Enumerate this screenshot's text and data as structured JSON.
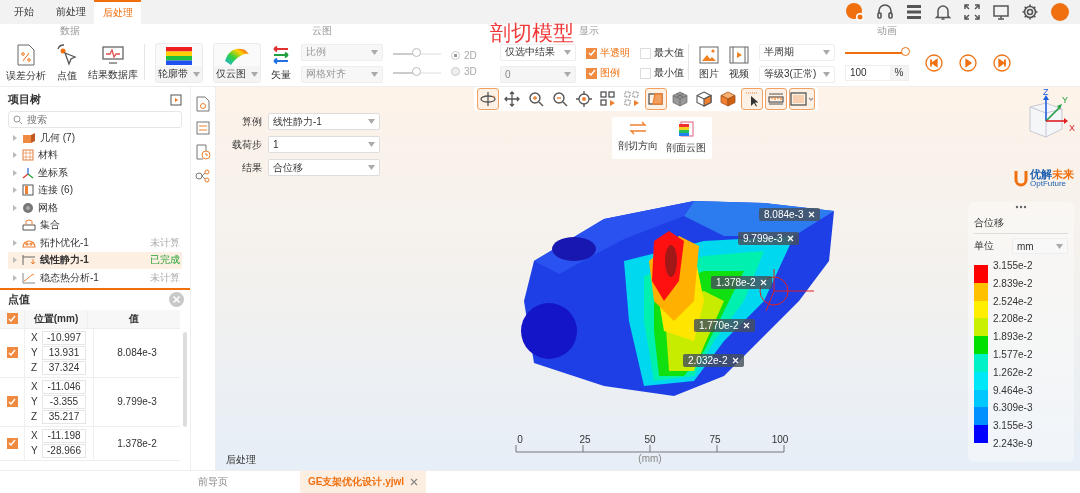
{
  "top_tabs": [
    {
      "label": "开始",
      "selected": false
    },
    {
      "label": "前处理",
      "selected": false
    },
    {
      "label": "后处理",
      "selected": true
    }
  ],
  "annotation_title": "剖切模型",
  "ribbon": {
    "data": {
      "title": "数据",
      "buttons": [
        {
          "kind": "error",
          "label": "误差分析"
        },
        {
          "kind": "probe",
          "label": "点值"
        },
        {
          "kind": "database",
          "label": "结果数据库"
        }
      ]
    },
    "contour": {
      "title": "云图",
      "band_button": "轮廓带",
      "cloud_button": "仅云图",
      "vector_button": "矢量",
      "scale_select": "比例",
      "mesh_select": "网格对齐",
      "sliders": [
        {
          "level": 0.5
        },
        {
          "level": 0.5
        }
      ],
      "modes": [
        {
          "label": "2D",
          "selected": true
        },
        {
          "label": "3D",
          "selected": false
        }
      ]
    },
    "display": {
      "title": "显示",
      "result_select": "仅选中结果",
      "step_select": "0",
      "checks": [
        {
          "label": "半透明",
          "checked": true
        },
        {
          "label": "最大值",
          "checked": false
        },
        {
          "label": "图例",
          "checked": true
        },
        {
          "label": "最小值",
          "checked": false
        }
      ]
    },
    "animation": {
      "title": "动画",
      "image_button": "图片",
      "video_button": "视频",
      "period_select": "半周期",
      "grade_select": "等级3(正常)",
      "speed": {
        "level": 1
      },
      "percent_value": "100",
      "percent_unit": "%"
    }
  },
  "project_tree": {
    "title": "项目树",
    "search_placeholder": "搜索",
    "items": [
      {
        "label": "几何 (7)",
        "kind": "geometry",
        "expandable": true,
        "selected": false
      },
      {
        "label": "材料",
        "kind": "material",
        "expandable": true,
        "selected": false
      },
      {
        "label": "坐标系",
        "kind": "axes",
        "expandable": true,
        "selected": false
      },
      {
        "label": "连接 (6)",
        "kind": "connection",
        "expandable": true,
        "selected": false
      },
      {
        "label": "网格",
        "kind": "mesh",
        "expandable": true,
        "selected": false
      },
      {
        "label": "集合",
        "kind": "set",
        "expandable": false,
        "selected": false
      },
      {
        "label": "拓扑优化-1",
        "kind": "topology",
        "expandable": true,
        "selected": false,
        "status": "未计算",
        "done": false
      },
      {
        "label": "线性静力-1",
        "kind": "static",
        "expandable": true,
        "selected": true,
        "status": "已完成",
        "done": true
      },
      {
        "label": "稳态热分析-1",
        "kind": "thermal",
        "expandable": true,
        "selected": false,
        "status": "未计算",
        "done": false
      }
    ]
  },
  "point_values": {
    "title": "点值",
    "all_checked": true,
    "columns": [
      "位置(mm)",
      "值"
    ],
    "rows": [
      {
        "checked": true,
        "coords": [
          {
            "axis": "X",
            "value": "-10.997"
          },
          {
            "axis": "Y",
            "value": "13.931"
          },
          {
            "axis": "Z",
            "value": "37.324"
          }
        ],
        "value": "8.084e-3"
      },
      {
        "checked": true,
        "coords": [
          {
            "axis": "X",
            "value": "-11.046"
          },
          {
            "axis": "Y",
            "value": "-3.355"
          },
          {
            "axis": "Z",
            "value": "35.217"
          }
        ],
        "value": "9.799e-3"
      },
      {
        "checked": true,
        "coords": [
          {
            "axis": "X",
            "value": "-11.198"
          },
          {
            "axis": "Y",
            "value": "-28.966"
          }
        ],
        "value": "1.378e-2"
      }
    ]
  },
  "side_tools": [
    {
      "kind": "model"
    },
    {
      "kind": "settings"
    },
    {
      "kind": "history"
    },
    {
      "kind": "share"
    }
  ],
  "view_toolbar": [
    {
      "kind": "rotate",
      "selected": true
    },
    {
      "kind": "pan",
      "selected": false
    },
    {
      "kind": "zoom_in",
      "selected": false
    },
    {
      "kind": "zoom_out",
      "selected": false
    },
    {
      "kind": "target",
      "selected": false
    },
    {
      "kind": "grid_select",
      "selected": false
    },
    {
      "kind": "grid_deselect",
      "selected": false
    },
    {
      "kind": "section",
      "selected": true
    },
    {
      "kind": "mesh_cube",
      "selected": false
    },
    {
      "kind": "cube",
      "selected": false
    },
    {
      "kind": "shaded_cube",
      "selected": false
    },
    {
      "kind": "pick",
      "selected": true
    },
    {
      "kind": "ruler",
      "selected": true
    },
    {
      "kind": "frame",
      "selected": true
    }
  ],
  "section_menu": [
    {
      "kind": "direction",
      "label": "剖切方向"
    },
    {
      "kind": "contour",
      "label": "剖面云图"
    }
  ],
  "form": [
    {
      "label": "算例",
      "value": "线性静力-1"
    },
    {
      "label": "载荷步",
      "value": "1"
    },
    {
      "label": "结果",
      "value": "合位移"
    }
  ],
  "triad": {
    "x": "X",
    "y": "Y",
    "z": "Z"
  },
  "logo": {
    "name_a": "优解",
    "name_b": "未来",
    "sub": "OptFuture"
  },
  "probes": [
    {
      "value": "8.084e-3"
    },
    {
      "value": "9.799e-3"
    },
    {
      "value": "1.378e-2"
    },
    {
      "value": "1.770e-2"
    },
    {
      "value": "2.032e-2"
    }
  ],
  "legend": {
    "title": "合位移",
    "unit_label": "单位",
    "unit_value": "mm",
    "bands": [
      {
        "color": "#ff0000"
      },
      {
        "color": "#ffc000"
      },
      {
        "color": "#ffee00"
      },
      {
        "color": "#c8f000"
      },
      {
        "color": "#00e000"
      },
      {
        "color": "#00f0c8"
      },
      {
        "color": "#00e8f8"
      },
      {
        "color": "#00c8ff"
      },
      {
        "color": "#0090ff"
      },
      {
        "color": "#0000ff"
      }
    ],
    "ticks": [
      "3.155e-2",
      "2.839e-2",
      "2.524e-2",
      "2.208e-2",
      "1.893e-2",
      "1.577e-2",
      "1.262e-2",
      "9.464e-3",
      "6.309e-3",
      "3.155e-3",
      "2.243e-9"
    ]
  },
  "scale_bar": {
    "ticks": [
      "0",
      "25",
      "50",
      "75",
      "100"
    ],
    "unit": "(mm)"
  },
  "viewport_label": "后处理",
  "bottom_tabs": [
    {
      "label": "前导页",
      "selected": false,
      "closable": false
    },
    {
      "label": "GE支架优化设计.yjwl",
      "selected": true,
      "closable": true
    }
  ]
}
